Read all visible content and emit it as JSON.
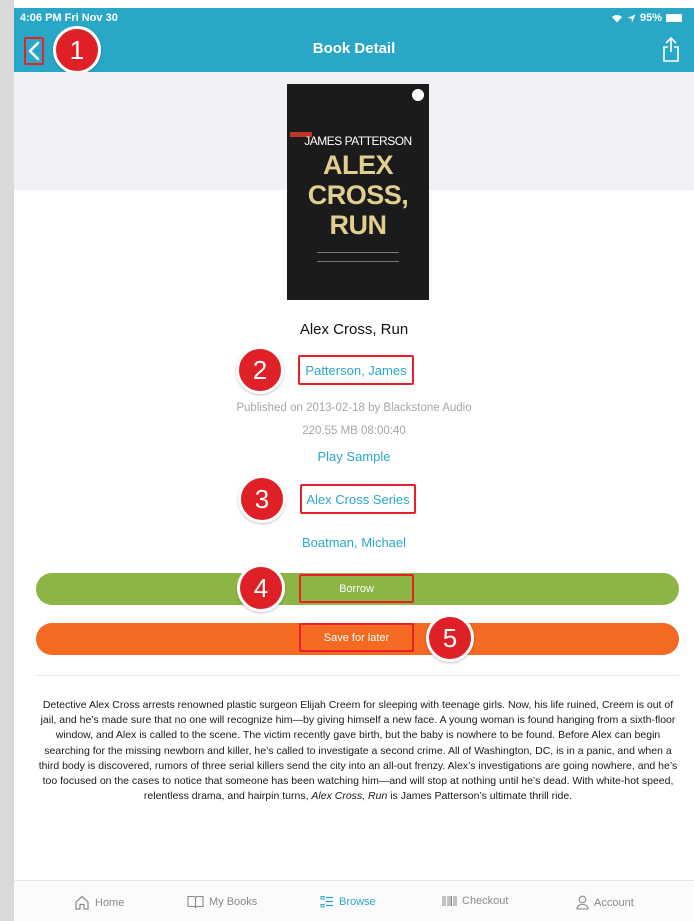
{
  "status_bar": {
    "time": "4:06 PM  Fri Nov 30",
    "battery": "95%"
  },
  "header": {
    "title": "Book Detail"
  },
  "cover": {
    "author_text": "JAMES PATTERSON",
    "title_lines": [
      "ALEX",
      "CROSS,",
      "RUN"
    ],
    "corner_icon": "audio-badge-icon"
  },
  "book": {
    "title": "Alex Cross, Run",
    "author": "Patterson, James",
    "published": "Published on 2013-02-18 by Blackstone Audio",
    "size_duration": "220.55 MB 08:00:40",
    "play_sample": "Play Sample",
    "series": "Alex Cross Series",
    "narrator": "Boatman, Michael"
  },
  "actions": {
    "borrow_label": "Borrow",
    "save_label": "Save for later",
    "borrow_color": "#8db545",
    "save_color": "#f46a22"
  },
  "annotations": [
    "1",
    "2",
    "3",
    "4",
    "5"
  ],
  "description": {
    "before": "Detective Alex Cross arrests renowned plastic surgeon Elijah Creem for sleeping with teenage girls. Now, his life ruined, Creem is out of jail, and he’s made sure that no one will recognize him—by giving himself a new face. A young woman is found hanging from a sixth-floor window, and Alex is called to the scene. The victim recently gave birth, but the baby is nowhere to be found. Before Alex can begin searching for the missing newborn and killer, he’s called to investigate a second crime. All of Washington, DC, is in a panic, and when a third body is discovered, rumors of three serial killers send the city into an all-out frenzy. Alex’s investigations are going nowhere, and he’s too focused on the cases to notice that someone has been watching him—and will stop at nothing until he’s dead. With white-hot speed, relentless drama, and hairpin turns, ",
    "italic": "Alex Cross, Run",
    "after": " is James Patterson’s ultimate thrill ride."
  },
  "nav": {
    "items": [
      {
        "label": "Home",
        "icon": "home-icon"
      },
      {
        "label": "My Books",
        "icon": "book-open-icon"
      },
      {
        "label": "Browse",
        "icon": "browse-list-icon",
        "active": true
      },
      {
        "label": "Checkout",
        "icon": "barcode-icon"
      },
      {
        "label": "Account",
        "icon": "person-icon"
      }
    ]
  },
  "colors": {
    "accent": "#29a7c6",
    "highlight_red": "#e8202a"
  }
}
